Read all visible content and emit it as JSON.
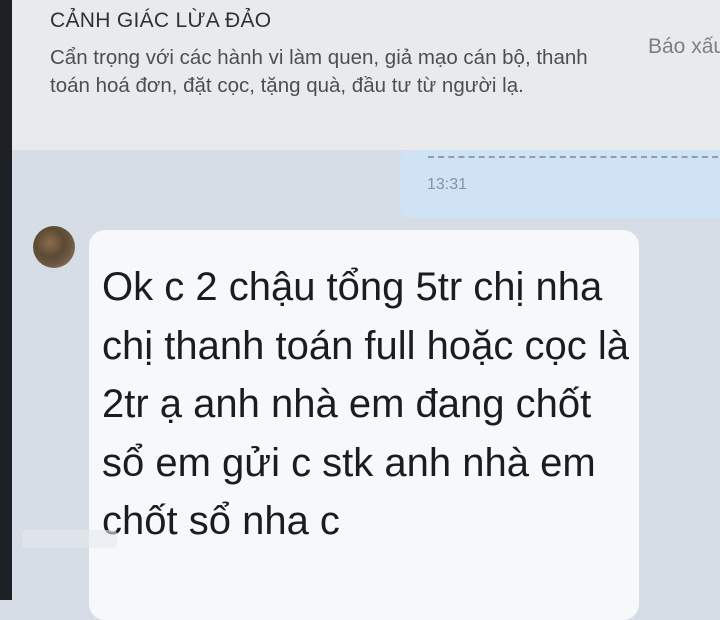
{
  "warning": {
    "title": "CẢNH GIÁC LỪA ĐẢO",
    "body": "Cẩn trọng với các hành vi làm quen, giả mạo cán bộ, thanh toán hoá đơn, đặt cọc, tặng quà, đầu tư từ người lạ.",
    "report_label": "Báo xấu"
  },
  "previous_message": {
    "time": "13:31"
  },
  "incoming_message": {
    "text": "Ok c 2 chậu tổng 5tr chị nha chị thanh toán full hoặc cọc là 2tr ạ anh nhà em đang chốt sổ em gửi c stk anh nhà em chốt sổ nha c"
  }
}
